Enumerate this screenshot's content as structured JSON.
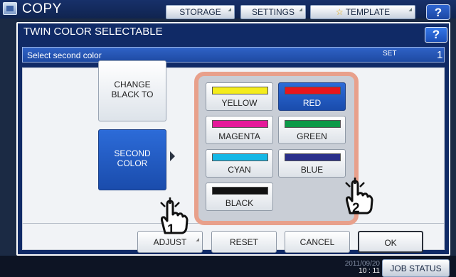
{
  "background": {
    "app_title": "COPY",
    "tabs": [
      {
        "label": "STORAGE"
      },
      {
        "label": "SETTINGS"
      },
      {
        "label": "TEMPLATE",
        "icon": "star-icon"
      }
    ],
    "help_label": "?",
    "clock_date": "2011/09/20",
    "clock_time": "10 : 11",
    "job_status_label": "JOB STATUS"
  },
  "dialog": {
    "title": "TWIN COLOR SELECTABLE",
    "help_label": "?",
    "subtitle": "Select second color",
    "set_label": "SET",
    "set_value": "1",
    "change_black_label": "CHANGE BLACK TO",
    "second_color_label": "SECOND COLOR",
    "colors": [
      {
        "label": "YELLOW",
        "swatch": "#f4ec1c",
        "selected": false
      },
      {
        "label": "RED",
        "swatch": "#e8161c",
        "selected": true
      },
      {
        "label": "MAGENTA",
        "swatch": "#e5189a",
        "selected": false
      },
      {
        "label": "GREEN",
        "swatch": "#0c9a48",
        "selected": false
      },
      {
        "label": "CYAN",
        "swatch": "#15b8e6",
        "selected": false
      },
      {
        "label": "BLUE",
        "swatch": "#2a2f8a",
        "selected": false
      },
      {
        "label": "BLACK",
        "swatch": "#121212",
        "selected": false
      }
    ],
    "footer": {
      "adjust_label": "ADJUST",
      "reset_label": "RESET",
      "cancel_label": "CANCEL",
      "ok_label": "OK"
    },
    "callouts": [
      "1",
      "2"
    ]
  },
  "colors": {
    "accent_blue": "#1e4aa2",
    "palette_border": "#e8a08b",
    "dialog_bg": "#102a66"
  }
}
